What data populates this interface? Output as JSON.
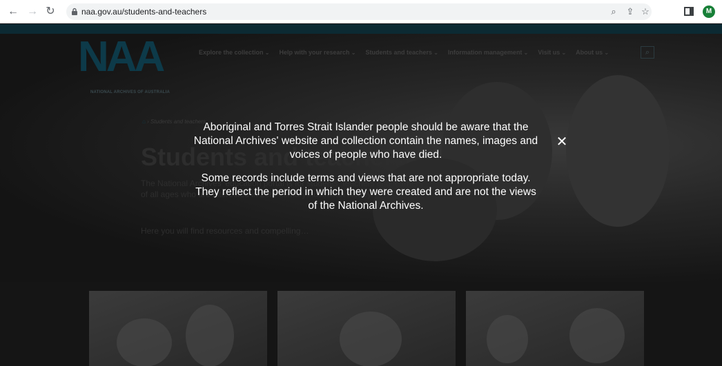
{
  "browser": {
    "url": "naa.gov.au/students-and-teachers",
    "profile_initial": "M",
    "icons": [
      "back-icon",
      "forward-icon",
      "reload-icon",
      "lock-icon",
      "zoom-icon",
      "share-icon",
      "star-icon",
      "sidebar-icon"
    ]
  },
  "site": {
    "logo_letters": "NAA",
    "logo_sub": "NATIONAL ARCHIVES OF AUSTRALIA",
    "nav": [
      "Explore the collection",
      "Help with your research",
      "Students and teachers",
      "Information management",
      "Visit us",
      "About us"
    ],
    "breadcrumb_current": "Students and teachers",
    "title": "Students and teachers",
    "intro_1": "The National Archives' education portal is for students, teachers and learners of all ages who are interested in 20th-century Australian history.",
    "intro_2": "Here you will find resources and compelling…"
  },
  "modal": {
    "paragraph_1": "Aboriginal and Torres Strait Islander people should be aware that the National Archives' website and collection contain the names, images and voices of people who have died.",
    "paragraph_2": "Some records include terms and views that are not appropriate today. They reflect the period in which they were created and are not the views of the National Archives.",
    "close_symbol": "✕"
  },
  "colors": {
    "brand": "#0d3a49",
    "overlay_text": "#ffffff"
  }
}
